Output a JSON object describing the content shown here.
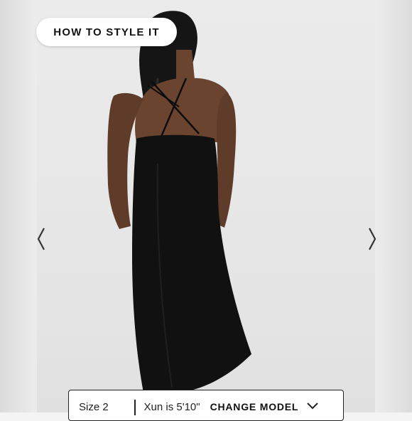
{
  "style_button": {
    "label": "HOW TO STYLE IT"
  },
  "carousel": {
    "prev_icon": "chevron-left-icon",
    "next_icon": "chevron-right-icon"
  },
  "size_bar": {
    "size_label": "Size 2",
    "model_text": "Xun is 5'10\"",
    "change_model_label": "CHANGE MODEL",
    "dropdown_icon": "chevron-down-icon"
  },
  "colors": {
    "dress": "#111111",
    "skin": "#6b4430",
    "background": "#e8e8e8"
  }
}
